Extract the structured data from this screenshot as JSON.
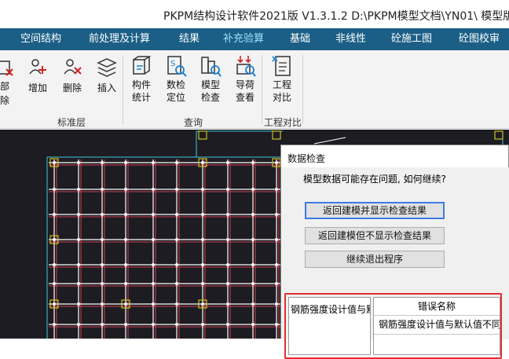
{
  "titlebar": {
    "title": "PKPM结构设计软件2021版 V1.3.1.2 D:\\PKPM模型文档\\YN01\\  模型版"
  },
  "menubar": {
    "items": [
      {
        "label": "空间结构"
      },
      {
        "label": "前处理及计算"
      },
      {
        "label": "结果"
      },
      {
        "label": "补充验算"
      },
      {
        "label": "基础"
      },
      {
        "label": "非线性"
      },
      {
        "label": "砼施工图"
      },
      {
        "label": "砼图校审"
      }
    ]
  },
  "ribbon": {
    "partial_label_top": "部",
    "partial_label_bottom": "除",
    "buttons": [
      {
        "label": "增加"
      },
      {
        "label": "删除"
      },
      {
        "label": "插入"
      },
      {
        "label_line1": "构件",
        "label_line2": "统计"
      },
      {
        "label_line1": "数检",
        "label_line2": "定位"
      },
      {
        "label_line1": "模型",
        "label_line2": "检查"
      },
      {
        "label_line1": "导荷",
        "label_line2": "查看"
      },
      {
        "label_line1": "工程",
        "label_line2": "对比"
      }
    ],
    "groups": [
      {
        "label": "标准层"
      },
      {
        "label": "查询"
      },
      {
        "label": "工程对比"
      }
    ]
  },
  "colors": {
    "menubar_bg": "#1b5f86",
    "canvas_bg": "#1c1c22",
    "grid_white": "#ffffff",
    "grid_red": "#d04050",
    "grid_cyan": "#40c8d8",
    "node_yellow": "#f0e020",
    "highlight_red": "#e03030",
    "default_button_border": "#3d7be5"
  },
  "dialog": {
    "title": "数据检查",
    "message": "模型数据可能存在问题, 如何继续?",
    "buttons": [
      {
        "label": "返回建模并显示检查结果",
        "default": true
      },
      {
        "label": "返回建模但不显示检查结果"
      },
      {
        "label": "继续退出程序"
      }
    ],
    "left_list": {
      "items": [
        "钢筋强度设计值与默"
      ]
    },
    "grid": {
      "header": "错误名称",
      "rows": [
        "钢筋强度设计值与默认值不同"
      ]
    }
  }
}
